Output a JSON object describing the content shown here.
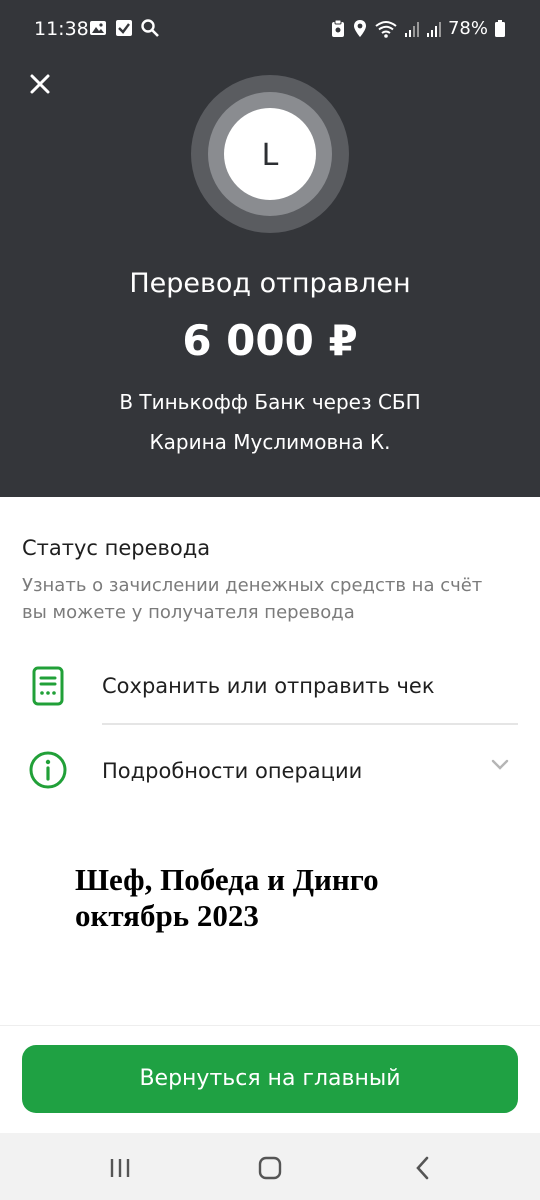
{
  "status_bar": {
    "time": "11:38",
    "battery": "78%",
    "left_icons": [
      "gallery-icon",
      "checkbox-icon",
      "search-icon"
    ],
    "right_icons": [
      "clipboard-icon",
      "location-icon",
      "wifi-icon",
      "signal-icon",
      "signal-icon",
      "battery-icon"
    ]
  },
  "hero": {
    "avatar_letter": "L",
    "title": "Перевод отправлен",
    "amount": "6 000 ₽",
    "bank_line": "В Тинькофф Банк через СБП",
    "recipient": "Карина Муслимовна К."
  },
  "status": {
    "title": "Статус перевода",
    "description": "Узнать о зачислении денежных средств на счёт вы можете у получателя перевода"
  },
  "actions": [
    {
      "label": "Сохранить или отправить чек",
      "icon": "receipt-icon"
    },
    {
      "label": "Подробности операции",
      "icon": "info-icon"
    }
  ],
  "overlay": {
    "line1": "Шеф, Победа и Динго",
    "line2": "октябрь 2023"
  },
  "home_button": {
    "label": "Вернуться на главный"
  },
  "colors": {
    "hero_bg": "#34363a",
    "accent_green": "#1fa143",
    "icon_green": "#21a038"
  }
}
